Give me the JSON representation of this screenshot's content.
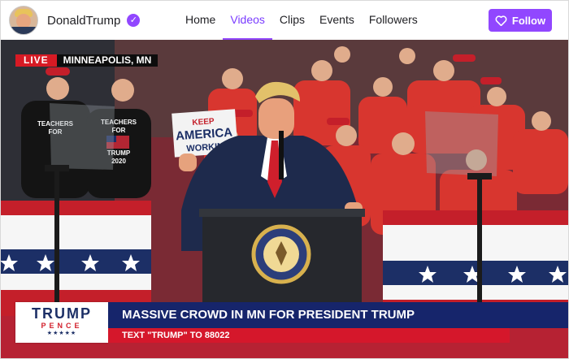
{
  "channel": {
    "name": "DonaldTrump",
    "avatar_icon": "avatar-photo",
    "verified_icon": "verified-check-icon"
  },
  "nav": {
    "items": [
      {
        "label": "Home",
        "active": false
      },
      {
        "label": "Videos",
        "active": true
      },
      {
        "label": "Clips",
        "active": false
      },
      {
        "label": "Events",
        "active": false
      },
      {
        "label": "Followers",
        "active": false
      }
    ]
  },
  "follow": {
    "label": "Follow",
    "icon": "heart-icon",
    "color": "#9147ff"
  },
  "video": {
    "live_label": "LIVE",
    "location": "MINNEAPOLIS, MN",
    "sign_text": [
      "KEEP",
      "AMERICA",
      "WORKIN"
    ],
    "shirt_texts": [
      [
        "TEACHERS",
        "FOR"
      ],
      [
        "TEACHERS",
        "FOR",
        "TRUMP",
        "2020"
      ]
    ],
    "lower_third": {
      "logo_main": "TRUMP",
      "logo_sub": "PENCE",
      "logo_stars": "★★★★★",
      "headline": "MASSIVE CROWD IN MN FOR PRESIDENT TRUMP",
      "subline": "TEXT \"TRUMP\" TO 88022"
    }
  },
  "colors": {
    "accent": "#9147ff",
    "live_red": "#d71a24",
    "headline_blue": "#16256b",
    "subline_red": "#d5172b"
  }
}
